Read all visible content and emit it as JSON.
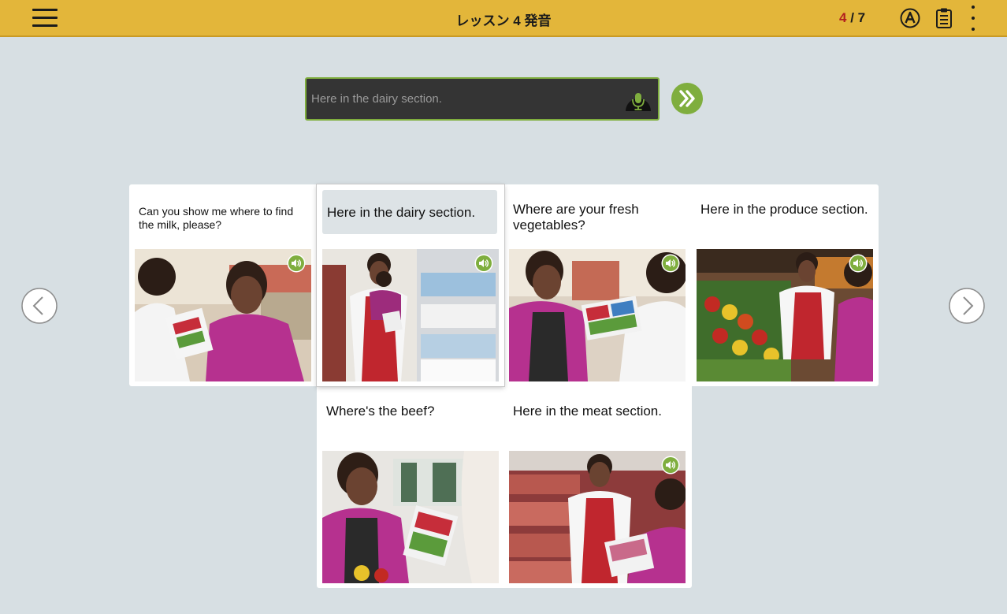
{
  "header": {
    "title": "レッスン 4 発音",
    "counter_current": "4",
    "counter_sep": " / ",
    "counter_total": "7"
  },
  "answer": {
    "text": "Here in the dairy section."
  },
  "colors": {
    "header_bg": "#e3b63a",
    "accent_green": "#7fae3e",
    "counter_current": "#b21f1f",
    "page_bg": "#d7dfe3"
  },
  "icons": {
    "menu": "hamburger-menu-icon",
    "font": "circled-a-icon",
    "notes": "clipboard-icon",
    "more": "vertical-dots-icon",
    "mic": "microphone-icon",
    "next": "double-chevron-right-icon",
    "speaker": "speaker-icon",
    "prev_page": "chevron-left-icon",
    "next_page": "chevron-right-icon"
  },
  "cards": [
    {
      "text": "Can you show me where to find the milk, please?",
      "selected": false
    },
    {
      "text": "Here in the dairy section.",
      "selected": true
    },
    {
      "text": "Where are your fresh vegetables?",
      "selected": false
    },
    {
      "text": "Here in the produce section.",
      "selected": false
    },
    {
      "text": "Where's the beef?",
      "selected": false
    },
    {
      "text": "Here in the meat section.",
      "selected": false
    }
  ]
}
